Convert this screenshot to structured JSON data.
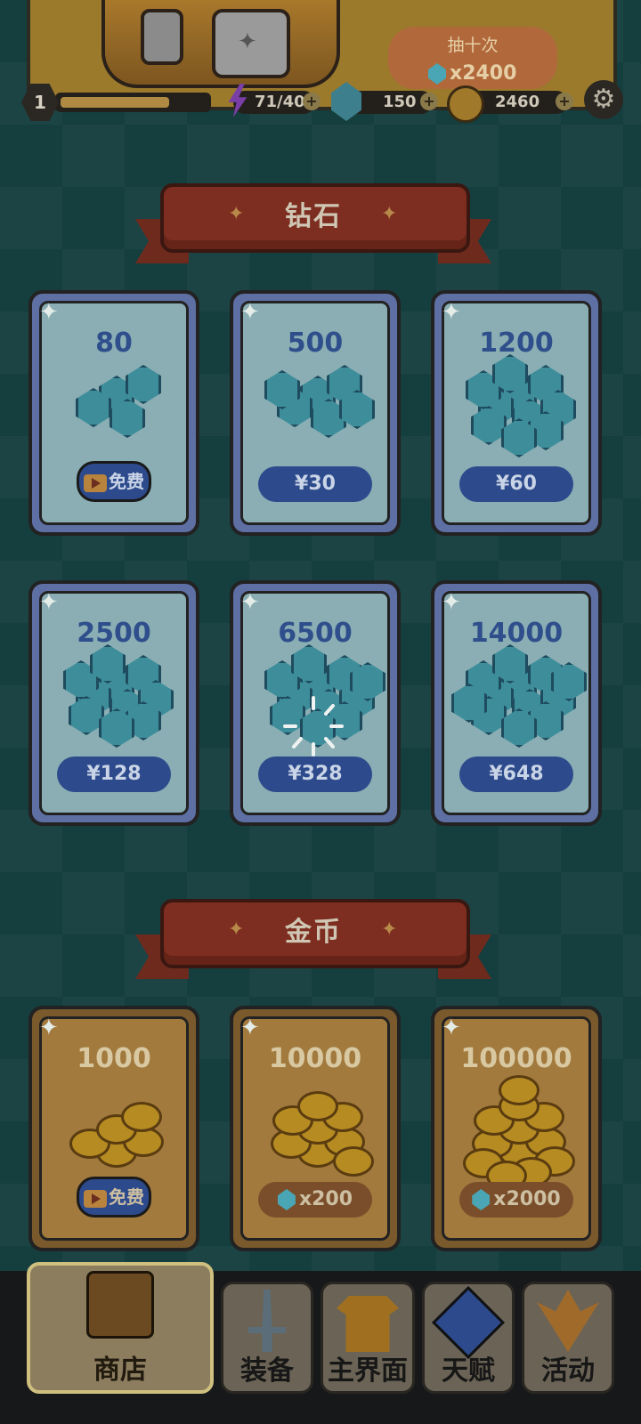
{
  "top_panel": {
    "draw_button_label": "抽十次",
    "draw_button_cost": "x2400"
  },
  "status": {
    "level": "1",
    "xp_fraction": 0.75,
    "energy": "71/40",
    "gems": "150",
    "coins": "2460",
    "plus": "+"
  },
  "sections": {
    "diamonds_title": "钻石",
    "gold_title": "金币"
  },
  "diamond_offers": [
    {
      "amount": "80",
      "price": "免费",
      "free": true
    },
    {
      "amount": "500",
      "price": "¥30"
    },
    {
      "amount": "1200",
      "price": "¥60"
    },
    {
      "amount": "2500",
      "price": "¥128"
    },
    {
      "amount": "6500",
      "price": "¥328"
    },
    {
      "amount": "14000",
      "price": "¥648"
    }
  ],
  "gold_offers": [
    {
      "amount": "1000",
      "price": "免费",
      "free": true
    },
    {
      "amount": "10000",
      "price": "x200"
    },
    {
      "amount": "100000",
      "price": "x2000"
    }
  ],
  "nav": {
    "tabs": [
      {
        "label": "商店",
        "icon": "shop-chest-icon",
        "active": true
      },
      {
        "label": "装备",
        "icon": "sword-shield-icon"
      },
      {
        "label": "主界面",
        "icon": "armor-icon"
      },
      {
        "label": "天赋",
        "icon": "talent-key-icon"
      },
      {
        "label": "活动",
        "icon": "event-trophy-icon"
      }
    ]
  },
  "colors": {
    "background": "#153e3e",
    "ribbon": "#7d2e20",
    "gem_card": "#5e6fa3",
    "gold_card": "#7a5a2c",
    "price_pill": "#2d4a8c"
  }
}
